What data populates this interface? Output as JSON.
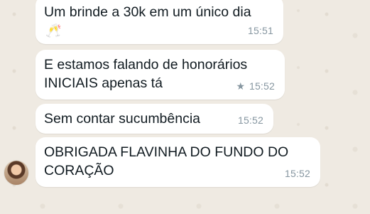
{
  "messages": [
    {
      "text": "Um brinde a 30k em um único dia",
      "emoji": "🥂",
      "time": "15:51",
      "starred": false
    },
    {
      "text": "E estamos falando de honorários\nINICIAIS apenas tá",
      "time": "15:52",
      "starred": true,
      "star_glyph": "★"
    },
    {
      "text": "Sem contar sucumbência",
      "time": "15:52",
      "starred": false
    },
    {
      "text": "OBRIGADA FLAVINHA DO FUNDO DO\nCORAÇÃO",
      "time": "15:52",
      "starred": false
    }
  ],
  "icons": {
    "avatar": "contact-avatar",
    "star": "star-icon"
  },
  "colors": {
    "bubble": "#ffffff",
    "wallpaper": "#efeae2",
    "meta": "#8696a0",
    "text": "#111b21"
  }
}
